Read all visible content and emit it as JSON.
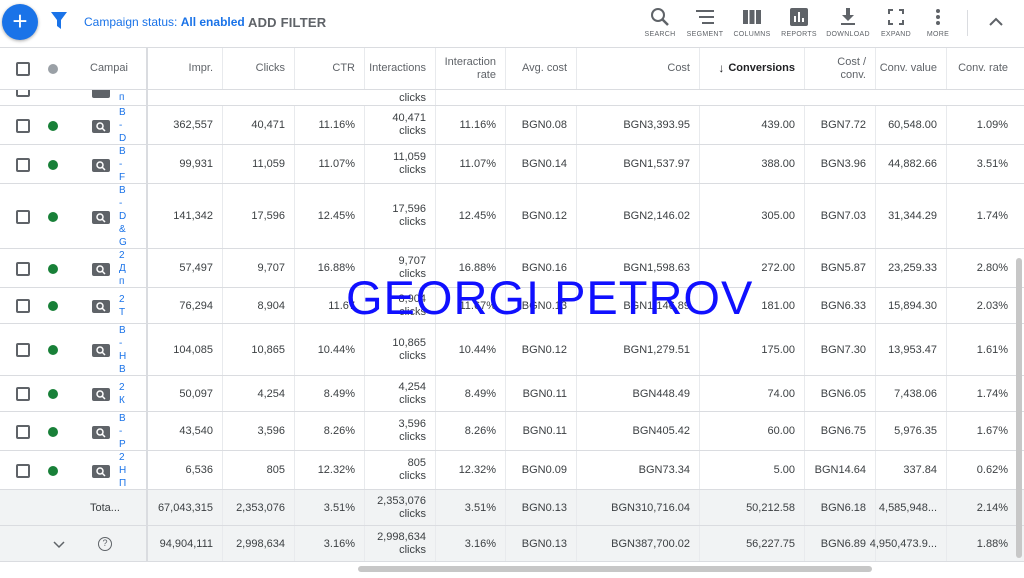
{
  "toolbar": {
    "status_prefix": "Campaign status: ",
    "status_value": "All enabled",
    "add_filter": "ADD FILTER",
    "tools": [
      {
        "name": "search-icon",
        "label": "SEARCH"
      },
      {
        "name": "segment-icon",
        "label": "SEGMENT"
      },
      {
        "name": "columns-icon",
        "label": "COLUMNS"
      },
      {
        "name": "reports-icon",
        "label": "REPORTS"
      },
      {
        "name": "download-icon",
        "label": "DOWNLOAD"
      },
      {
        "name": "expand-icon",
        "label": "EXPAND"
      },
      {
        "name": "more-icon",
        "label": "MORE"
      }
    ]
  },
  "table": {
    "headers": {
      "campaign": "Campai",
      "impr": "Impr.",
      "clicks": "Clicks",
      "ctr": "CTR",
      "interactions": "Interactions",
      "interaction_rate_1": "Interaction",
      "interaction_rate_2": "rate",
      "avg_cost": "Avg. cost",
      "cost": "Cost",
      "conversions": "Conversions",
      "cost_conv_1": "Cost /",
      "cost_conv_2": "conv.",
      "conv_value": "Conv. value",
      "conv_rate": "Conv. rate"
    },
    "partial_row": {
      "campaign": "п",
      "interactions_unit": "clicks"
    },
    "rows": [
      {
        "campaign": [
          "В",
          "-",
          "D"
        ],
        "impr": "362,557",
        "clicks": "40,471",
        "ctr": "11.16%",
        "interactions": "40,471",
        "interactions_unit": "clicks",
        "interaction_rate": "11.16%",
        "avg_cost": "BGN0.08",
        "cost": "BGN3,393.95",
        "conversions": "439.00",
        "cost_conv": "BGN7.72",
        "conv_value": "60,548.00",
        "conv_rate": "1.09%"
      },
      {
        "campaign": [
          "В",
          "-",
          "F"
        ],
        "impr": "99,931",
        "clicks": "11,059",
        "ctr": "11.07%",
        "interactions": "11,059",
        "interactions_unit": "clicks",
        "interaction_rate": "11.07%",
        "avg_cost": "BGN0.14",
        "cost": "BGN1,537.97",
        "conversions": "388.00",
        "cost_conv": "BGN3.96",
        "conv_value": "44,882.66",
        "conv_rate": "3.51%"
      },
      {
        "campaign": [
          "В",
          "-",
          "D",
          "&",
          "G"
        ],
        "impr": "141,342",
        "clicks": "17,596",
        "ctr": "12.45%",
        "interactions": "17,596",
        "interactions_unit": "clicks",
        "interaction_rate": "12.45%",
        "avg_cost": "BGN0.12",
        "cost": "BGN2,146.02",
        "conversions": "305.00",
        "cost_conv": "BGN7.03",
        "conv_value": "31,344.29",
        "conv_rate": "1.74%"
      },
      {
        "campaign": [
          "2",
          "Д",
          "п"
        ],
        "impr": "57,497",
        "clicks": "9,707",
        "ctr": "16.88%",
        "interactions": "9,707",
        "interactions_unit": "clicks",
        "interaction_rate": "16.88%",
        "avg_cost": "BGN0.16",
        "cost": "BGN1,598.63",
        "conversions": "272.00",
        "cost_conv": "BGN5.87",
        "conv_value": "23,259.33",
        "conv_rate": "2.80%"
      },
      {
        "campaign": [
          "2",
          "Т"
        ],
        "impr": "76,294",
        "clicks": "8,904",
        "ctr": "11.67",
        "interactions": "8,904",
        "interactions_unit": "clicks",
        "interaction_rate": "11.67%",
        "avg_cost": "BGN0.13",
        "cost": "BGN1,146.89",
        "conversions": "181.00",
        "cost_conv": "BGN6.33",
        "conv_value": "15,894.30",
        "conv_rate": "2.03%"
      },
      {
        "campaign": [
          "В",
          "-",
          "Н",
          "В"
        ],
        "impr": "104,085",
        "clicks": "10,865",
        "ctr": "10.44%",
        "interactions": "10,865",
        "interactions_unit": "clicks",
        "interaction_rate": "10.44%",
        "avg_cost": "BGN0.12",
        "cost": "BGN1,279.51",
        "conversions": "175.00",
        "cost_conv": "BGN7.30",
        "conv_value": "13,953.47",
        "conv_rate": "1.61%"
      },
      {
        "campaign": [
          "2",
          "К"
        ],
        "impr": "50,097",
        "clicks": "4,254",
        "ctr": "8.49%",
        "interactions": "4,254",
        "interactions_unit": "clicks",
        "interaction_rate": "8.49%",
        "avg_cost": "BGN0.11",
        "cost": "BGN448.49",
        "conversions": "74.00",
        "cost_conv": "BGN6.05",
        "conv_value": "7,438.06",
        "conv_rate": "1.74%"
      },
      {
        "campaign": [
          "В",
          "-",
          "Р"
        ],
        "impr": "43,540",
        "clicks": "3,596",
        "ctr": "8.26%",
        "interactions": "3,596",
        "interactions_unit": "clicks",
        "interaction_rate": "8.26%",
        "avg_cost": "BGN0.11",
        "cost": "BGN405.42",
        "conversions": "60.00",
        "cost_conv": "BGN6.75",
        "conv_value": "5,976.35",
        "conv_rate": "1.67%"
      },
      {
        "campaign": [
          "2",
          "Н",
          "П"
        ],
        "impr": "6,536",
        "clicks": "805",
        "ctr": "12.32%",
        "interactions": "805",
        "interactions_unit": "clicks",
        "interaction_rate": "12.32%",
        "avg_cost": "BGN0.09",
        "cost": "BGN73.34",
        "conversions": "5.00",
        "cost_conv": "BGN14.64",
        "conv_value": "337.84",
        "conv_rate": "0.62%"
      }
    ],
    "total": {
      "label": "Tota...",
      "impr": "67,043,315",
      "clicks": "2,353,076",
      "ctr": "3.51%",
      "interactions": "2,353,076",
      "interactions_unit": "clicks",
      "interaction_rate": "3.51%",
      "avg_cost": "BGN0.13",
      "cost": "BGN310,716.04",
      "conversions": "50,212.58",
      "cost_conv": "BGN6.18",
      "conv_value": "4,585,948...",
      "conv_rate": "2.14%"
    },
    "grand": {
      "impr": "94,904,111",
      "clicks": "2,998,634",
      "ctr": "3.16%",
      "interactions": "2,998,634",
      "interactions_unit": "clicks",
      "interaction_rate": "3.16%",
      "avg_cost": "BGN0.13",
      "cost": "BGN387,700.02",
      "conversions": "56,227.75",
      "cost_conv": "BGN6.89",
      "conv_value": "4,950,473.9...",
      "conv_rate": "1.88%"
    }
  },
  "watermark": "GEORGI PETROV",
  "colors": {
    "accent": "#1a73e8",
    "enabled_dot": "#188038",
    "watermark": "#1010ff"
  }
}
